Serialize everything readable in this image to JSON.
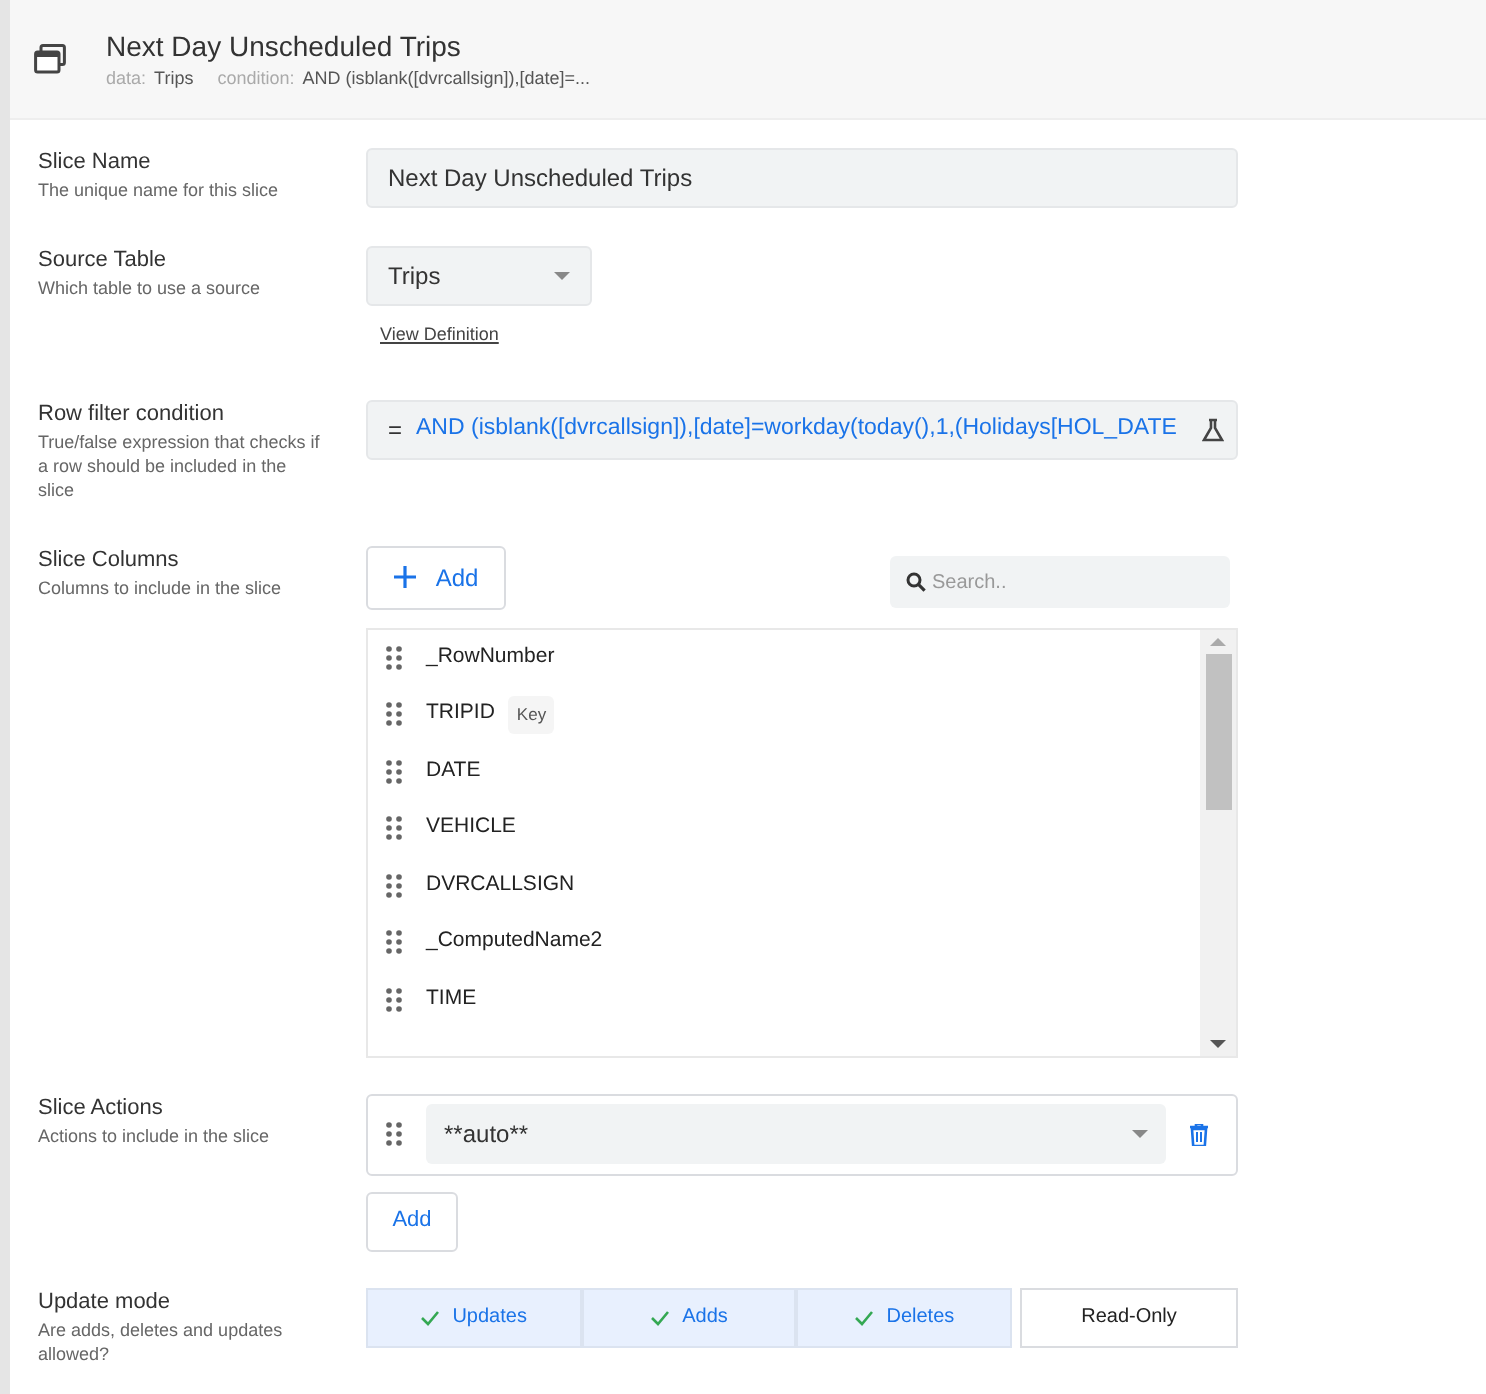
{
  "header": {
    "title": "Next Day Unscheduled Trips",
    "data_label": "data:",
    "data_value": "Trips",
    "condition_label": "condition:",
    "condition_value": "AND (isblank([dvrcallsign]),[date]=..."
  },
  "slice_name": {
    "label": "Slice Name",
    "hint": "The unique name for this slice",
    "value": "Next Day Unscheduled Trips"
  },
  "source_table": {
    "label": "Source Table",
    "hint": "Which table to use a source",
    "value": "Trips",
    "link": "View Definition"
  },
  "row_filter": {
    "label": "Row filter condition",
    "hint": "True/false expression that checks if a row should be included in the slice",
    "prefix": "=",
    "value": "AND (isblank([dvrcallsign]),[date]=workday(today(),1,(Holidays[HOL_DATE"
  },
  "slice_columns": {
    "label": "Slice Columns",
    "hint": "Columns to include in the slice",
    "add": "Add",
    "search_placeholder": "Search..",
    "columns": [
      {
        "name": "_RowNumber"
      },
      {
        "name": "TRIPID",
        "badge": "Key"
      },
      {
        "name": "DATE"
      },
      {
        "name": "VEHICLE"
      },
      {
        "name": "DVRCALLSIGN"
      },
      {
        "name": "_ComputedName2"
      },
      {
        "name": "TIME"
      }
    ]
  },
  "slice_actions": {
    "label": "Slice Actions",
    "hint": "Actions to include in the slice",
    "value": "**auto**",
    "add": "Add"
  },
  "update_mode": {
    "label": "Update mode",
    "hint": "Are adds, deletes and updates allowed?",
    "options": [
      {
        "label": "Updates",
        "selected": true
      },
      {
        "label": "Adds",
        "selected": true
      },
      {
        "label": "Deletes",
        "selected": true
      },
      {
        "label": "Read-Only",
        "selected": false
      }
    ]
  }
}
